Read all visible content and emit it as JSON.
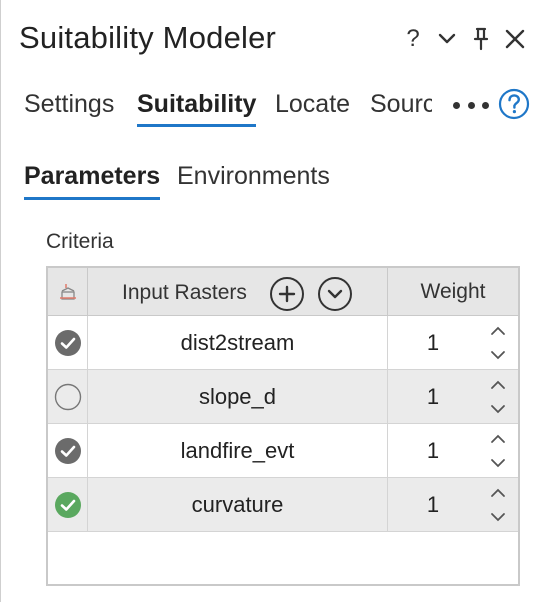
{
  "window": {
    "title": "Suitability Modeler",
    "help_glyph": "?",
    "buttons": [
      "help-icon",
      "chevron-down-icon",
      "pin-icon",
      "close-icon"
    ]
  },
  "tabs": [
    {
      "label": "Settings",
      "active": false
    },
    {
      "label": "Suitability",
      "active": true
    },
    {
      "label": "Locate",
      "active": false
    },
    {
      "label": "Source",
      "active": false
    }
  ],
  "subtabs": [
    {
      "label": "Parameters",
      "active": true
    },
    {
      "label": "Environments",
      "active": false
    }
  ],
  "criteria": {
    "label": "Criteria",
    "columns": {
      "input": "Input Rasters",
      "weight": "Weight"
    },
    "rows": [
      {
        "name": "dist2stream",
        "weight": "1",
        "state": "checked"
      },
      {
        "name": "slope_d",
        "weight": "1",
        "state": "empty"
      },
      {
        "name": "landfire_evt",
        "weight": "1",
        "state": "checked"
      },
      {
        "name": "curvature",
        "weight": "1",
        "state": "valid"
      }
    ]
  },
  "colors": {
    "accent": "#1f77c8",
    "checked": "#6b6b6b",
    "valid": "#5aa85f"
  }
}
